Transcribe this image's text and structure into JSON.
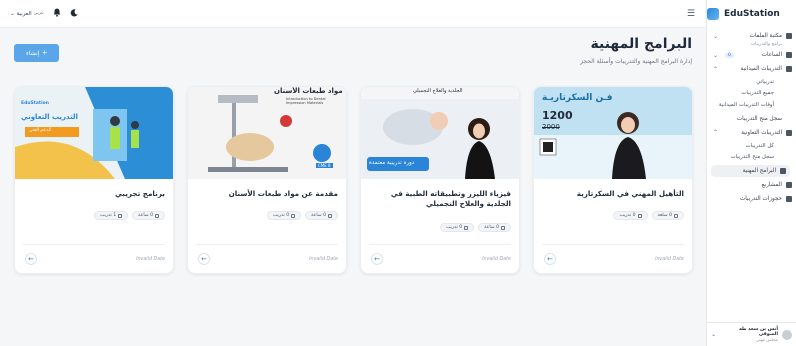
{
  "app": {
    "name": "EduStation"
  },
  "topbar": {
    "language": "العربية",
    "language_code": "عربي"
  },
  "sidebar": {
    "items": [
      {
        "label": "مكتبة الملفات",
        "chevron": "⌄"
      },
      {
        "sub": "برامج والتدريبات"
      },
      {
        "label": "الساعات",
        "badge": "0",
        "chevron": "⌄"
      },
      {
        "label": "التدريبات الميدانية",
        "chevron": "⌃"
      }
    ],
    "field_children": [
      "تدريباتي",
      "جميع التدريبات",
      "أوقات التدريبات الميدانية"
    ],
    "field_log": "سجل منح التدريبات",
    "coop": {
      "label": "التدريبات التعاونية",
      "chevron": "⌃"
    },
    "coop_children": [
      "كل التدريبات",
      "سجل منح التدريبات"
    ],
    "bottom_items": [
      {
        "label": "البرامج المهنية"
      },
      {
        "label": "المشاريع"
      },
      {
        "label": "حجوزات التدريبات"
      }
    ],
    "user": {
      "name": "أنس بن سعد طه الصوفي",
      "role": "مجلس مهني"
    }
  },
  "page": {
    "title": "البرامج المهنية",
    "subtitle": "إدارة البرامج المهنية والتدريبات وأسئلة الحجز",
    "create_label": "إنشاء"
  },
  "cards": [
    {
      "title": "التأهيل المهني في السكرتارية",
      "chips": [
        "0 سلعة",
        "0 تدريب"
      ],
      "date": "Invalid Date",
      "thumb_text": {
        "head": "فـن السكرتاريـة",
        "price": "1200",
        "old": "2000"
      }
    },
    {
      "title": "فيزياء الليزر وتطبيقاته الطبية في الجلدية والعلاج التجميلي",
      "chips": [
        "0 ساعة",
        "0 تدريب"
      ],
      "date": "Invalid Date",
      "thumb_text": {
        "head": "الجلدية والعلاج التجميلي",
        "badge": "دورة تدريبية معتمدة"
      }
    },
    {
      "title": "مقدمة عن مواد طبعات الأسنان",
      "chips": [
        "0 ساعة",
        "0 تدريب"
      ],
      "date": "Invalid Date",
      "thumb_text": {
        "head": "مواد طبعات الأسنان",
        "en": "Introduction to Dental Impression Materials",
        "badge": "CME 8"
      }
    },
    {
      "title": "برنامج تجريبي",
      "chips": [
        "0 ساعة",
        "1 تدريب"
      ],
      "date": "Invalid Date",
      "thumb_text": {
        "head": "التدريب التعاوني",
        "brand": "EduStation",
        "small": "الدعم الفني"
      }
    }
  ],
  "colors": {
    "accent": "#5aa6e8",
    "brand": "#2a84d8",
    "arrow": "#3b82c4"
  }
}
